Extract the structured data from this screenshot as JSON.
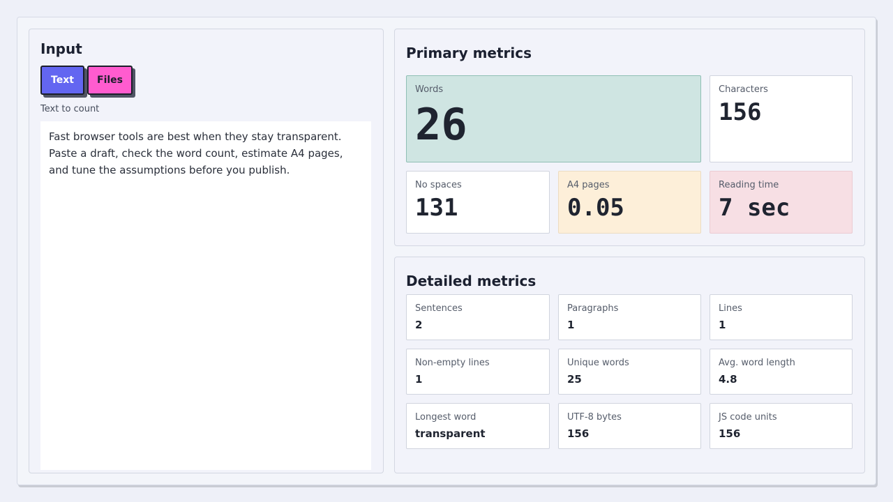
{
  "input": {
    "title": "Input",
    "tabs": {
      "text": "Text",
      "files": "Files"
    },
    "field_label": "Text to count",
    "text": "Fast browser tools are best when they stay transparent. Paste a draft, check the word count, estimate A4 pages, and tune the assumptions before you publish."
  },
  "primary": {
    "title": "Primary metrics",
    "words": {
      "label": "Words",
      "value": "26"
    },
    "characters": {
      "label": "Characters",
      "value": "156"
    },
    "no_spaces": {
      "label": "No spaces",
      "value": "131"
    },
    "a4_pages": {
      "label": "A4 pages",
      "value": "0.05"
    },
    "reading_time": {
      "label": "Reading time",
      "value": "7 sec"
    }
  },
  "detailed": {
    "title": "Detailed metrics",
    "sentences": {
      "label": "Sentences",
      "value": "2"
    },
    "paragraphs": {
      "label": "Paragraphs",
      "value": "1"
    },
    "lines": {
      "label": "Lines",
      "value": "1"
    },
    "non_empty_lines": {
      "label": "Non-empty lines",
      "value": "1"
    },
    "unique_words": {
      "label": "Unique words",
      "value": "25"
    },
    "avg_word_length": {
      "label": "Avg. word length",
      "value": "4.8"
    },
    "longest_word": {
      "label": "Longest word",
      "value": "transparent"
    },
    "utf8_bytes": {
      "label": "UTF-8 bytes",
      "value": "156"
    },
    "js_code_units": {
      "label": "JS code units",
      "value": "156"
    }
  },
  "colors": {
    "accent_text_tab": "#6366f1",
    "accent_files_tab": "#ff5ccf",
    "words_card": "#cfe5e2",
    "a4_card": "#fdefd9",
    "reading_card": "#f7dfe4"
  }
}
